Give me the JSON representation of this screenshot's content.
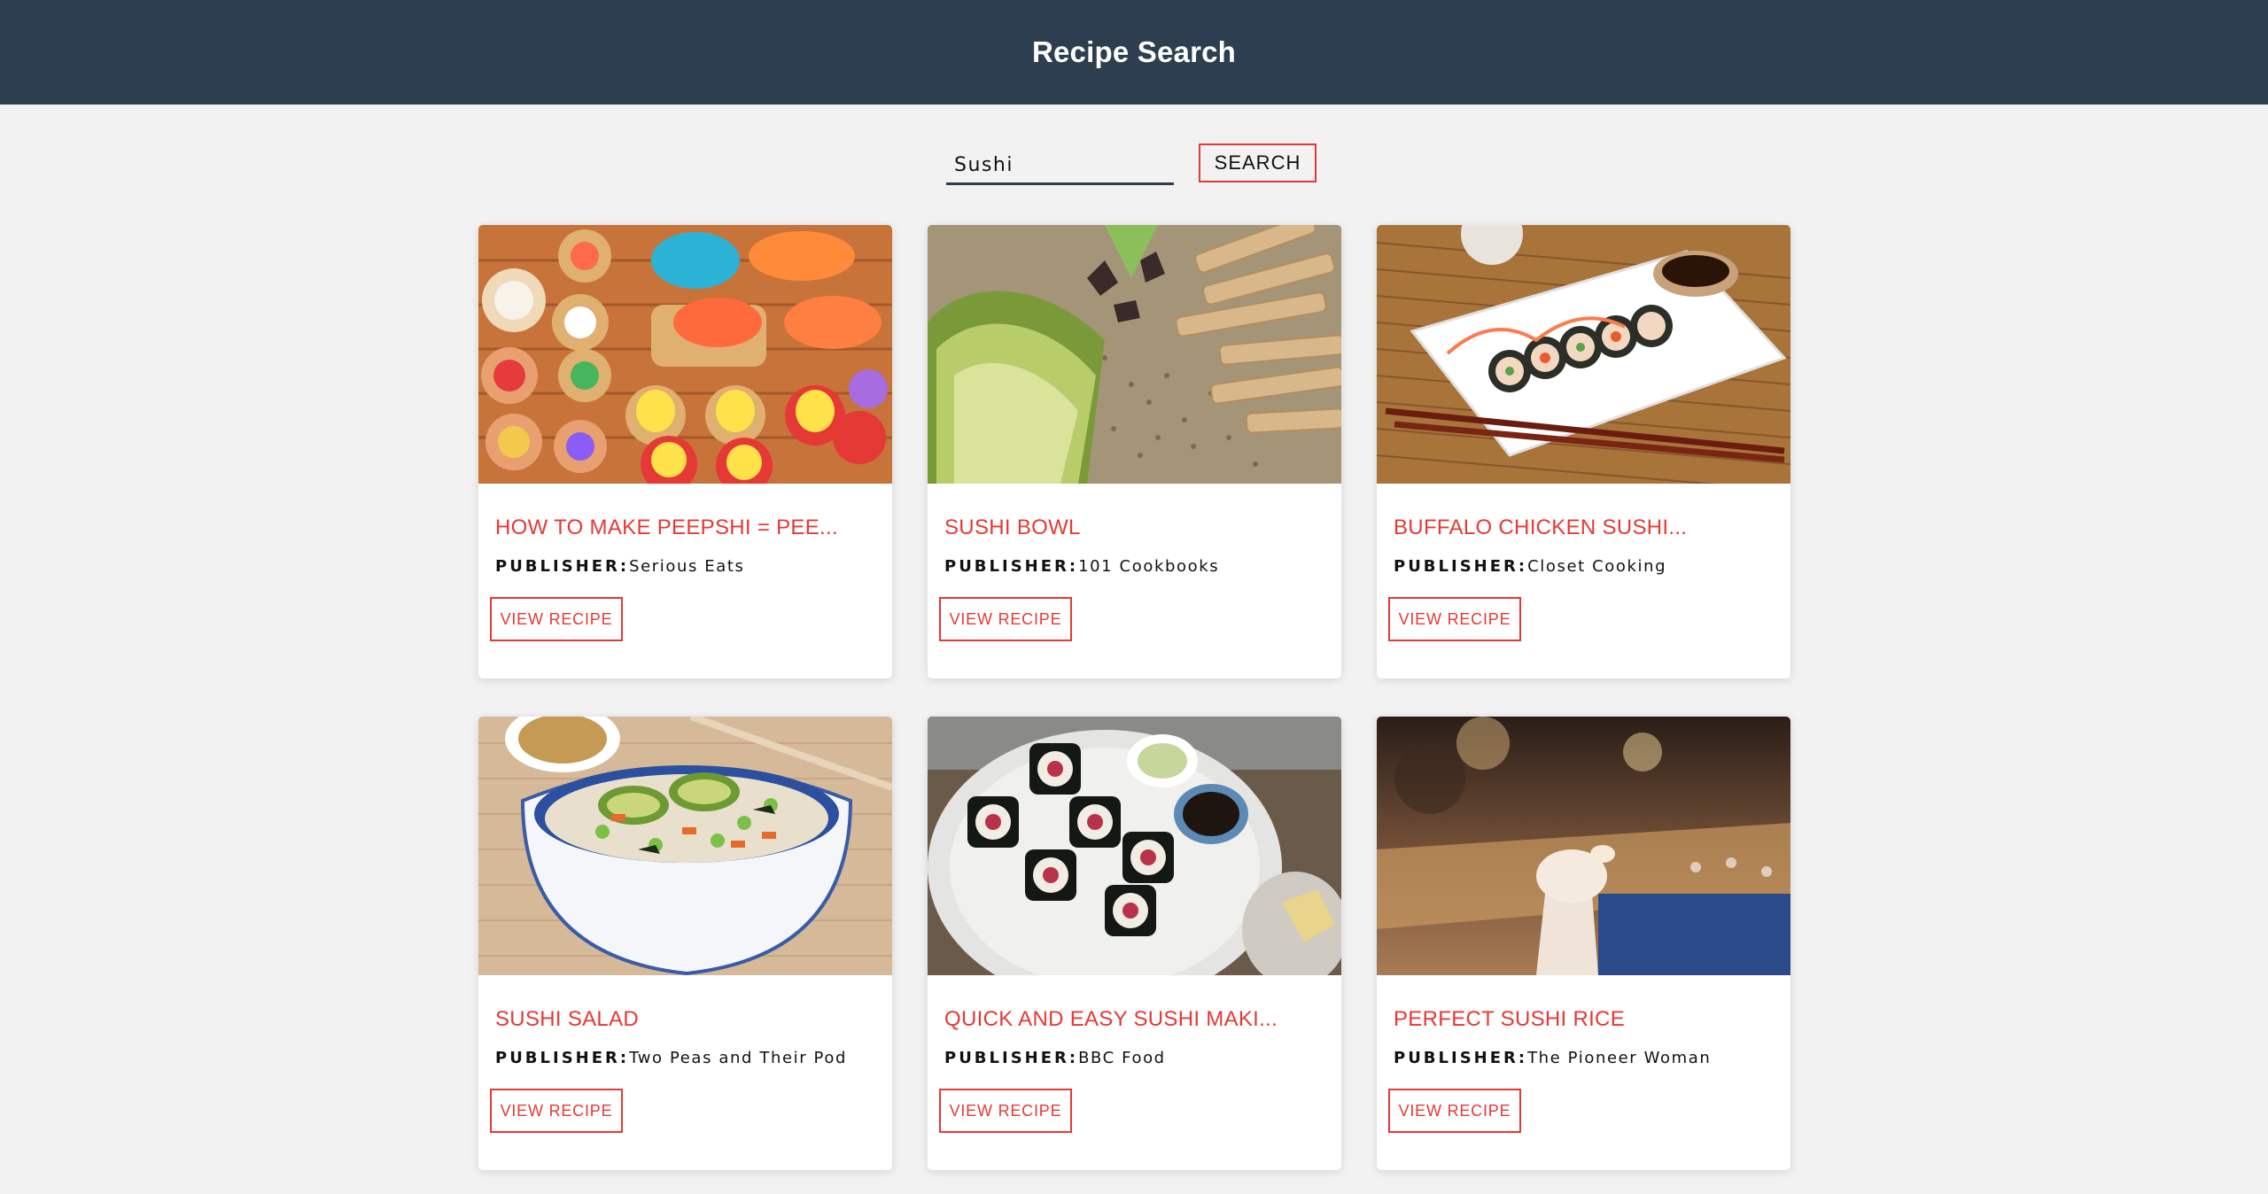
{
  "header": {
    "title": "Recipe Search"
  },
  "search": {
    "value": "Sushi",
    "button_label": "SEARCH"
  },
  "publisher_label": "PUBLISHER:",
  "view_label": "VIEW RECIPE",
  "recipes": [
    {
      "title": "HOW TO MAKE PEEPSHI = PEE...",
      "publisher": "Serious Eats",
      "image": "peepshi-photo"
    },
    {
      "title": "SUSHI BOWL",
      "publisher": "101 Cookbooks",
      "image": "sushi-bowl-photo"
    },
    {
      "title": "BUFFALO CHICKEN SUSHI...",
      "publisher": "Closet Cooking",
      "image": "buffalo-chicken-sushi-photo"
    },
    {
      "title": "SUSHI SALAD",
      "publisher": "Two Peas and Their Pod",
      "image": "sushi-salad-photo"
    },
    {
      "title": "QUICK AND EASY SUSHI MAKI...",
      "publisher": "BBC Food",
      "image": "sushi-maki-photo"
    },
    {
      "title": "PERFECT SUSHI RICE",
      "publisher": "The Pioneer Woman",
      "image": "sushi-rice-photo"
    }
  ],
  "colors": {
    "header_bg": "#2c3e50",
    "accent": "#e53935",
    "page_bg": "#f2f2f2"
  }
}
